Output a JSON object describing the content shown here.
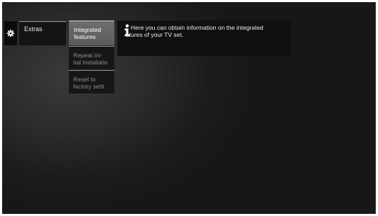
{
  "sidebar": {
    "icon": "gear-icon",
    "menu_label": "Extras"
  },
  "submenu": {
    "items": [
      {
        "label": "Integrated\nfeatures",
        "selected": true
      },
      {
        "label": "Repeat ini-\ntial installatio",
        "selected": false
      },
      {
        "label": "Reset to\nfactory setti",
        "selected": false
      }
    ]
  },
  "info": {
    "icon": "info-icon",
    "line1": "Here you can obtain information on the integrated",
    "line2": "atures of your TV set."
  },
  "colors": {
    "background": "#171717",
    "selected_item": "#666666",
    "text": "#ffffff",
    "dim_text": "#8f8f8f"
  }
}
